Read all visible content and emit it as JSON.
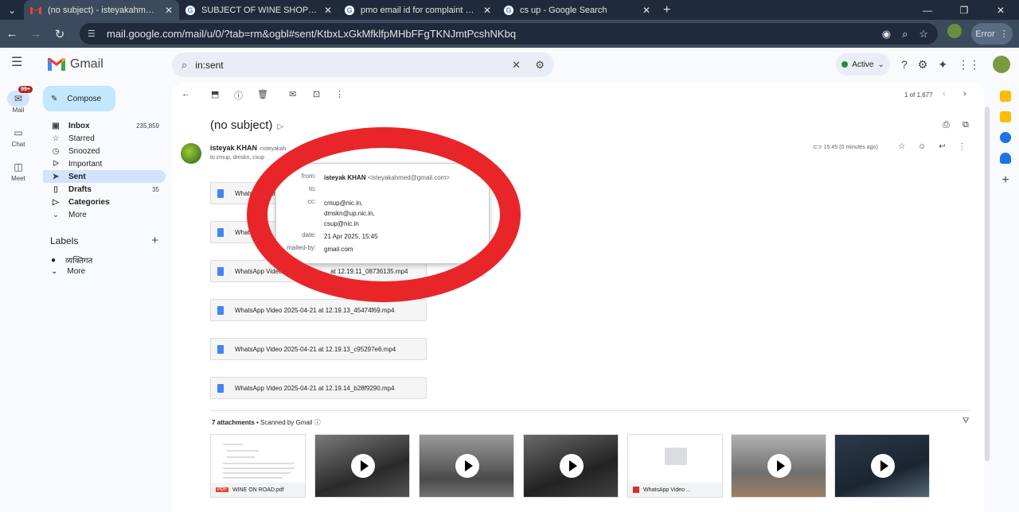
{
  "browser": {
    "tabs": [
      {
        "title": "(no subject) - isteyakahmed@g",
        "icon": "gmail-icon",
        "active": true
      },
      {
        "title": "SUBJECT OF WINE SHOP CLOSU",
        "icon": "google-icon"
      },
      {
        "title": "pmo email id for complaint - G",
        "icon": "google-icon"
      },
      {
        "title": "cs up - Google Search",
        "icon": "google-icon"
      }
    ],
    "url": "mail.google.com/mail/u/0/?tab=rm&ogbl#sent/KtbxLxGkMfklfpMHbFFgTKNJmtPcshNKbq",
    "error_label": "Error"
  },
  "gmail": {
    "product": "Gmail",
    "search_value": "in:sent",
    "status": "Active",
    "compose": "Compose",
    "rail": [
      {
        "label": "Mail",
        "badge": "99+"
      },
      {
        "label": "Chat"
      },
      {
        "label": "Meet"
      }
    ],
    "nav": [
      {
        "label": "Inbox",
        "count": "235,859",
        "icon": "inbox-icon"
      },
      {
        "label": "Starred",
        "icon": "star-icon"
      },
      {
        "label": "Snoozed",
        "icon": "clock-icon"
      },
      {
        "label": "Important",
        "icon": "important-icon"
      },
      {
        "label": "Sent",
        "icon": "send-icon"
      },
      {
        "label": "Drafts",
        "count": "35",
        "icon": "draft-icon"
      },
      {
        "label": "Categories",
        "icon": "label-icon"
      },
      {
        "label": "More",
        "icon": "chevron-down-icon"
      }
    ],
    "labels_heading": "Labels",
    "labels": [
      "व्यक्तिगत"
    ],
    "labels_more": "More"
  },
  "message": {
    "pager": "1 of 1,677",
    "subject": "(no subject)",
    "sender_name": "isteyak KHAN",
    "sender_email": "<isteyakah",
    "to_line": "to cmup, dmskn, csup",
    "timestamp": "15:45 (0 minutes ago)",
    "attachments": [
      "WhatsApp Vid",
      "What",
      "WhatsApp Video 2",
      "WhatsApp Video 2025-04-21 at 12.19.13_45474f69.mp4",
      "WhatsApp Video 2025-04-21 at 12.19.13_c95297e6.mp4",
      "WhatsApp Video 2025-04-21 at 12.19.14_b28f9290.mp4"
    ],
    "attachment_tail": "at 12.19.11_08736135.mp4",
    "attachments_count": "7 attachments",
    "scanned": "• Scanned by Gmail",
    "thumbs": [
      {
        "caption": "WINE ON ROAD.pdf",
        "kind": "pdf"
      },
      {
        "kind": "video"
      },
      {
        "kind": "video"
      },
      {
        "kind": "video"
      },
      {
        "caption": "WhatsApp Video ...",
        "kind": "placeholder"
      },
      {
        "kind": "video"
      },
      {
        "kind": "video"
      }
    ]
  },
  "details_popup": {
    "from_label": "from:",
    "from_name": "isteyak KHAN",
    "from_email": "<isteyakahmed@gmail.com>",
    "to_label": "to:",
    "cc_label": "cc:",
    "cc": [
      "cmup@nic.in,",
      "dmskn@up.nic.in,",
      "csup@nic.in"
    ],
    "date_label": "date:",
    "date": "21 Apr 2025, 15:45",
    "mailedby_label": "mailed-by:",
    "mailedby": "gmail.com"
  },
  "colors": {
    "annotation_circle": "#e8262a",
    "sent_highlight": "#d3e3fd",
    "compose_bg": "#c2e7ff"
  }
}
